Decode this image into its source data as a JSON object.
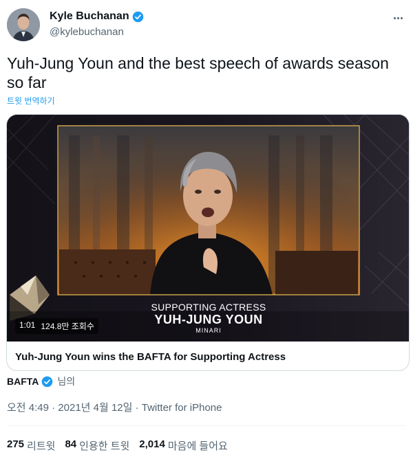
{
  "author": {
    "name": "Kyle Buchanan",
    "handle": "@kylebuchanan",
    "verified": true
  },
  "tweet": {
    "text": "Yuh-Jung Youn and the best speech of awards season so far",
    "translate_label": "트윗 번역하기"
  },
  "media": {
    "duration": "1:01",
    "views": "124.8만 조회수",
    "caption_role": "SUPPORTING ACTRESS",
    "caption_name": "YUH-JUNG YOUN",
    "caption_film": "MINARI",
    "card_title": "Yuh-Jung Youn wins the BAFTA for Supporting Actress"
  },
  "source": {
    "name": "BAFTA",
    "suffix": "님의",
    "verified": true
  },
  "meta": {
    "timestamp": "오전 4:49 · 2021년 4월 12일 · Twitter for iPhone"
  },
  "stats": [
    {
      "count": "275",
      "label": "리트윗"
    },
    {
      "count": "84",
      "label": "인용한 트윗"
    },
    {
      "count": "2,014",
      "label": "마음에 들어요"
    }
  ],
  "colors": {
    "accent": "#1d9bf0",
    "muted": "#536471",
    "gold_frame": "#c9a24a"
  }
}
